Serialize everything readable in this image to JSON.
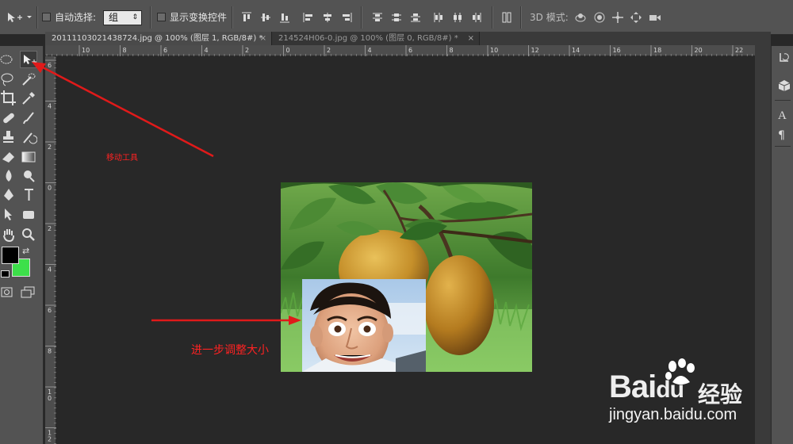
{
  "options_bar": {
    "auto_select_label": "自动选择:",
    "auto_select_value": "组",
    "show_transform_label": "显示变换控件",
    "mode_3d_label": "3D 模式:"
  },
  "tabs": [
    {
      "label": "20111103021438724.jpg @ 100% (图层 1, RGB/8#) *",
      "close": "×"
    },
    {
      "label": "214524H06-0.jpg @ 100% (图层 0, RGB/8#) *",
      "close": "×"
    }
  ],
  "ruler_top_labels": [
    "10",
    "8",
    "6",
    "4",
    "2",
    "0",
    "2",
    "4",
    "6",
    "8",
    "10",
    "12",
    "14",
    "16",
    "18",
    "20",
    "22"
  ],
  "ruler_left_labels": [
    "6",
    "4",
    "2",
    "0",
    "2",
    "4",
    "6",
    "8",
    "10",
    "12"
  ],
  "annotations": {
    "move_tool": "移动工具",
    "resize_hint": "进一步调整大小"
  },
  "watermark": {
    "brand": "Bai",
    "brand_paw": "du",
    "brand_cn": "经验",
    "url": "jingyan.baidu.com"
  },
  "colors": {
    "foreground": "#000000",
    "background": "#3de04a",
    "annotation": "#ff2222"
  },
  "right_panel_icons": [
    "history-icon",
    "3d-icon",
    "character-icon",
    "paragraph-icon"
  ],
  "right_panel_glyphs": {
    "character": "A",
    "paragraph": "¶"
  }
}
